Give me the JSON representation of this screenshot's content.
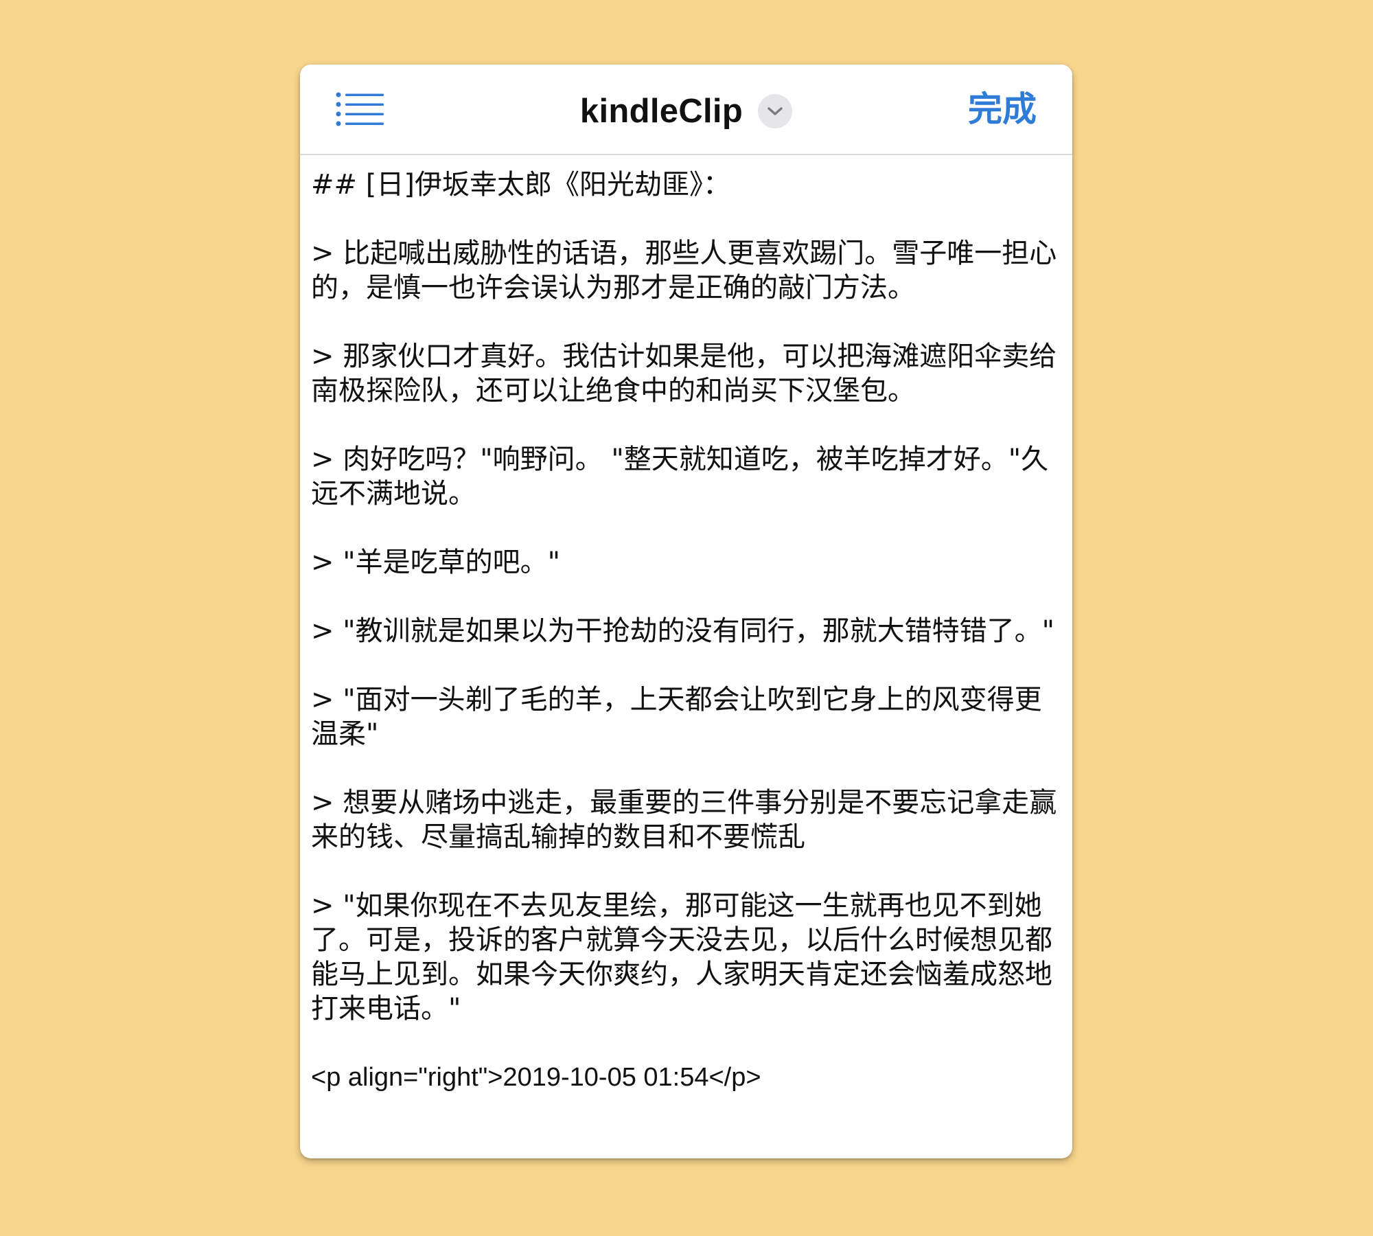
{
  "nav": {
    "title": "kindleClip",
    "done_label": "完成"
  },
  "icons": {
    "menu": "list-icon",
    "dropdown": "chevron-down-icon"
  },
  "colors": {
    "background": "#F7D58C",
    "accent": "#2E7BD8"
  },
  "content": {
    "paragraphs": [
      "## [日]伊坂幸太郎《阳光劫匪》：",
      "> 比起喊出威胁性的话语，那些人更喜欢踢门。雪子唯一担心的，是慎一也许会误认为那才是正确的敲门方法。",
      "> 那家伙口才真好。我估计如果是他，可以把海滩遮阳伞卖给南极探险队，还可以让绝食中的和尚买下汉堡包。",
      "> 肉好吃吗？\"响野问。 \"整天就知道吃，被羊吃掉才好。\"久远不满地说。",
      "> \"羊是吃草的吧。\"",
      "> \"教训就是如果以为干抢劫的没有同行，那就大错特错了。\"",
      "> \"面对一头剃了毛的羊，上天都会让吹到它身上的风变得更温柔\"",
      "> 想要从赌场中逃走，最重要的三件事分别是不要忘记拿走赢来的钱、尽量搞乱输掉的数目和不要慌乱",
      "> \"如果你现在不去见友里绘，那可能这一生就再也见不到她了。可是，投诉的客户就算今天没去见，以后什么时候想见都能马上见到。如果今天你爽约，人家明天肯定还会恼羞成怒地打来电话。\"",
      "<p align=\"right\">2019-10-05 01:54</p>"
    ]
  }
}
